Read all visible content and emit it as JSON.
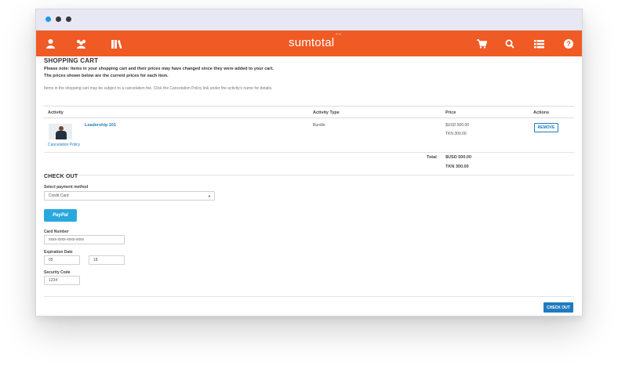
{
  "brand": {
    "name": "sumtotal",
    "mark": "⁺⁺"
  },
  "navbar": {
    "icons_left": [
      "user-icon",
      "people-icon",
      "library-icon"
    ],
    "icons_right": [
      "cart-icon",
      "search-icon",
      "list-icon",
      "help-icon"
    ],
    "help_glyph": "?"
  },
  "cart": {
    "title": "SHOPPING CART",
    "note1": "Please note: Items in your shopping cart and their prices may have changed since they were added to your cart.",
    "note2": "The prices shown below are the current prices for each item.",
    "cancel_note": "Items in the shopping cart may be subject to a cancelation fee. Click the Cancelation Policy link under the activity's name for details.",
    "columns": {
      "activity": "Activity",
      "type": "Activity Type",
      "price": "Price",
      "actions": "Actions"
    },
    "item": {
      "name": "Leadership 101",
      "policy_link": "Cancelation Policy",
      "type": "Bundle",
      "price_usd": "$USD 500.00",
      "price_tkn": "TKN 300.00",
      "remove_label": "REMOVE"
    },
    "total_label": "Total",
    "total_usd": "$USD 500.00",
    "total_tkn": "TKN 300.00"
  },
  "checkout": {
    "title": "CHECK OUT",
    "payment_label": "Select payment method",
    "payment_value": "Credit Card",
    "paypal_label": "PayPal",
    "card_label": "Card Number",
    "card_value": "xxxx-xxxx-xxxx-xxxx",
    "exp_label": "Expiration Date",
    "exp_month": "05",
    "exp_year": "18",
    "sec_label": "Security Code",
    "sec_value": "1234",
    "checkout_button": "CHECK OUT"
  },
  "colors": {
    "nav": "#f05a24",
    "accent": "#1f7bbf",
    "paypal": "#29a8e0"
  }
}
